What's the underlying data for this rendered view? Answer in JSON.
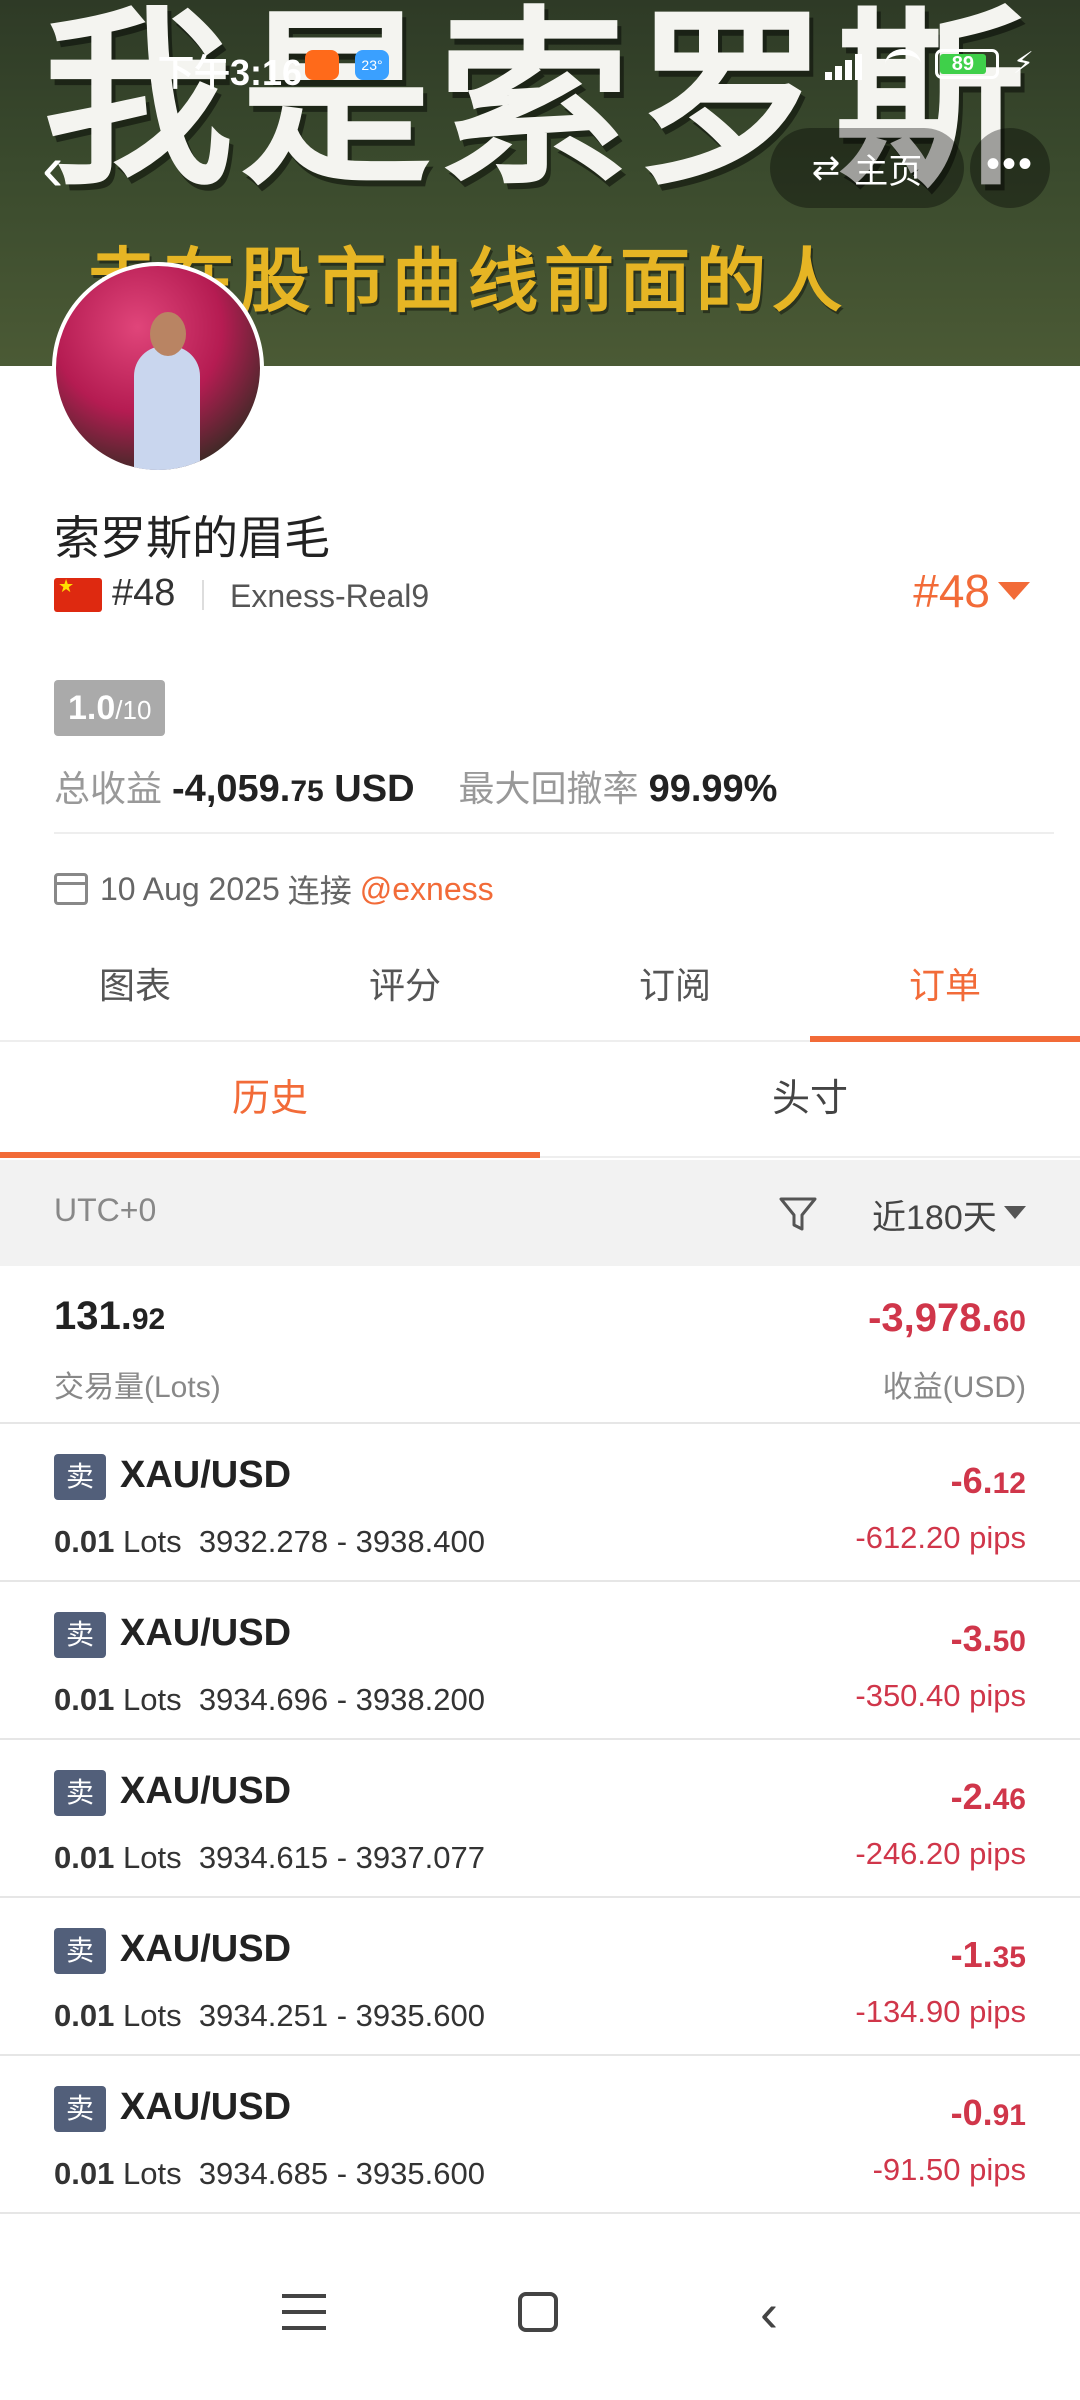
{
  "status_bar": {
    "time": "下午3:16",
    "weather_temp": "23°",
    "battery": "89"
  },
  "banner": {
    "title": "我是索罗斯",
    "subtitle": "走在股市曲线前面的人"
  },
  "top_nav": {
    "home_label": "主页"
  },
  "profile": {
    "name": "索罗斯的眉毛",
    "rank": "#48",
    "account": "Exness-Real9",
    "rank_large": "#48",
    "score": "1.0",
    "score_max": "/10",
    "total_profit_label": "总收益",
    "total_profit_value": "-4,059.",
    "total_profit_cents": "75",
    "total_profit_currency": "USD",
    "max_drawdown_label": "最大回撤率",
    "max_drawdown_value": "99.99%",
    "connect_date": "10 Aug 2025",
    "connect_label": "连接",
    "broker": "@exness"
  },
  "main_tabs": [
    {
      "label": "图表"
    },
    {
      "label": "评分"
    },
    {
      "label": "订阅"
    },
    {
      "label": "订单"
    }
  ],
  "sub_tabs": [
    {
      "label": "历史"
    },
    {
      "label": "头寸"
    }
  ],
  "filter": {
    "timezone": "UTC+0",
    "range": "近180天"
  },
  "summary": {
    "lots_main": "131.",
    "lots_cents": "92",
    "lots_label": "交易量(Lots)",
    "profit_main": "-3,978.",
    "profit_cents": "60",
    "profit_label": "收益(USD)"
  },
  "trades": [
    {
      "side": "卖",
      "symbol": "XAU/USD",
      "lots": "0.01",
      "lots_unit": "Lots",
      "prices": "3932.278 - 3938.400",
      "profit_main": "-6.",
      "profit_cents": "12",
      "pips": "-612.20 pips"
    },
    {
      "side": "卖",
      "symbol": "XAU/USD",
      "lots": "0.01",
      "lots_unit": "Lots",
      "prices": "3934.696 - 3938.200",
      "profit_main": "-3.",
      "profit_cents": "50",
      "pips": "-350.40 pips"
    },
    {
      "side": "卖",
      "symbol": "XAU/USD",
      "lots": "0.01",
      "lots_unit": "Lots",
      "prices": "3934.615 - 3937.077",
      "profit_main": "-2.",
      "profit_cents": "46",
      "pips": "-246.20 pips"
    },
    {
      "side": "卖",
      "symbol": "XAU/USD",
      "lots": "0.01",
      "lots_unit": "Lots",
      "prices": "3934.251 - 3935.600",
      "profit_main": "-1.",
      "profit_cents": "35",
      "pips": "-134.90 pips"
    },
    {
      "side": "卖",
      "symbol": "XAU/USD",
      "lots": "0.01",
      "lots_unit": "Lots",
      "prices": "3934.685 - 3935.600",
      "profit_main": "-0.",
      "profit_cents": "91",
      "pips": "-91.50 pips"
    }
  ],
  "colors": {
    "accent": "#f26b38",
    "loss": "#d0364a",
    "sell_badge": "#525f7a",
    "banner_title": "#f4f4f0",
    "banner_subtitle": "#e6b524"
  },
  "icons": [
    "back-icon",
    "swap-icon",
    "more-icon",
    "flag-icon",
    "calendar-icon",
    "funnel-icon",
    "menu-icon",
    "home-icon",
    "back-nav-icon"
  ]
}
